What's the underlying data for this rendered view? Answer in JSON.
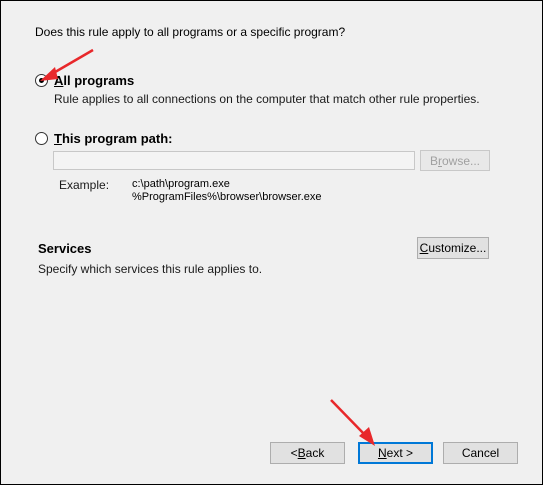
{
  "question": "Does this rule apply to all programs or a specific program?",
  "options": {
    "all_programs": {
      "label_accel": "A",
      "label_rest": "ll programs",
      "description": "Rule applies to all connections on the computer that match other rule properties.",
      "selected": true
    },
    "program_path": {
      "label_accel": "T",
      "label_rest": "his program path:",
      "selected": false,
      "input_value": "",
      "browse_accel": "r",
      "browse_pre": "B",
      "browse_post": "owse..."
    }
  },
  "example": {
    "label": "Example:",
    "line1": "c:\\path\\program.exe",
    "line2": "%ProgramFiles%\\browser\\browser.exe"
  },
  "services": {
    "title": "Services",
    "description": "Specify which services this rule applies to.",
    "customize_accel": "C",
    "customize_rest": "ustomize..."
  },
  "footer": {
    "back_pre": "< ",
    "back_accel": "B",
    "back_rest": "ack",
    "next_accel": "N",
    "next_rest": "ext >",
    "cancel": "Cancel"
  },
  "annotations": {
    "arrow_color": "#e8282b"
  }
}
